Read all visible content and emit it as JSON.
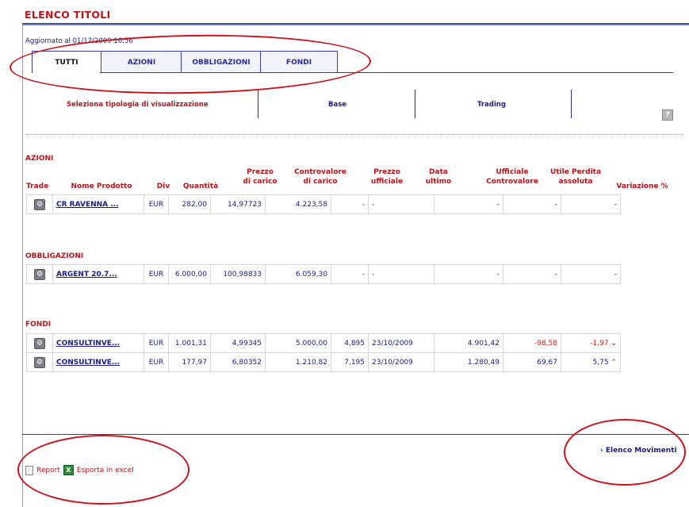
{
  "title": "ELENCO TITOLI",
  "updated": "Aggiornato al 01/12/2009 16:56",
  "tabs": [
    "TUTTI",
    "AZIONI",
    "OBBLIGAZIONI",
    "FONDI"
  ],
  "view_selector": {
    "label": "Seleziona tipologia di visualizzazione",
    "options": [
      "Base",
      "Trading"
    ]
  },
  "help_icon": "?",
  "columns": {
    "trade": "Trade",
    "nome": "Nome Prodotto",
    "div": "Div",
    "quantita": "Quantità",
    "prezzo_carico_1": "Prezzo",
    "prezzo_carico_2": "di carico",
    "controvalore_1": "Controvalore",
    "controvalore_2": "di carico",
    "prezzo_uff_1": "Prezzo",
    "prezzo_uff_2": "ufficiale",
    "data_1": "Data",
    "data_2": "ultimo",
    "uff_contr_1": "Ufficiale",
    "uff_contr_2": "Controvalore",
    "utile_1": "Utile Perdita",
    "utile_2": "assoluta",
    "variazione": "Variazione %"
  },
  "sections": {
    "azioni": {
      "label": "AZIONI",
      "rows": [
        {
          "name": "CR RAVENNA ...",
          "div": "EUR",
          "qty": "282,00",
          "prezzo": "14,97723",
          "controvalore": "4.223,58",
          "prezzo_uff": "-",
          "data": "-",
          "uff_contr": "-",
          "utile": "-",
          "var": "-"
        }
      ]
    },
    "obbligazioni": {
      "label": "OBBLIGAZIONI",
      "rows": [
        {
          "name": "ARGENT 20.7...",
          "div": "EUR",
          "qty": "6.000,00",
          "prezzo": "100,98833",
          "controvalore": "6.059,30",
          "prezzo_uff": "-",
          "data": "-",
          "uff_contr": "-",
          "utile": "-",
          "var": "-"
        }
      ]
    },
    "fondi": {
      "label": "FONDI",
      "rows": [
        {
          "name": "CONSULTINVE...",
          "div": "EUR",
          "qty": "1.001,31",
          "prezzo": "4,99345",
          "controvalore": "5.000,00",
          "prezzo_uff": "4,895",
          "data": "23/10/2009",
          "uff_contr": "4.901,42",
          "utile": "-98,58",
          "var": "-1,97"
        },
        {
          "name": "CONSULTINVE...",
          "div": "EUR",
          "qty": "177,97",
          "prezzo": "6,80352",
          "controvalore": "1.210,82",
          "prezzo_uff": "7,195",
          "data": "23/10/2009",
          "uff_contr": "1.280,49",
          "utile": "69,67",
          "var": "5,75"
        }
      ]
    }
  },
  "footer": {
    "movimenti": "› Elenco Movimenti",
    "report": "Report",
    "export": "Esporta in excel"
  },
  "colors": {
    "accent_red": "#b8141b",
    "navy": "#1a1a7a",
    "annotation_red": "#c8141c",
    "positive_green": "#1a9a3a"
  }
}
